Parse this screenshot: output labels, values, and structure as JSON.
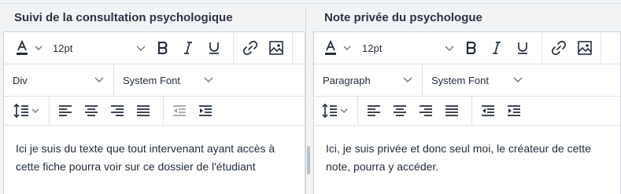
{
  "left": {
    "title": "Suivi de la consultation psychologique",
    "toolbar": {
      "font_size": "12pt",
      "block_format": "Div",
      "font_family": "System Font"
    },
    "content": "Ici je suis du texte que tout intervenant ayant accès à cette fiche pourra voir sur ce dossier de l'étudiant"
  },
  "right": {
    "title": "Note privée du psychologue",
    "toolbar": {
      "font_size": "12pt",
      "block_format": "Paragraph",
      "font_family": "System Font"
    },
    "content": "Ici, je suis privée et donc seul moi, le créateur de cette note, pourra y accéder."
  },
  "icons": [
    "text-color-icon",
    "chevron-down-icon",
    "bold-icon",
    "italic-icon",
    "underline-icon",
    "link-icon",
    "image-icon",
    "line-height-icon",
    "align-left-icon",
    "align-center-icon",
    "align-right-icon",
    "align-justify-icon",
    "outdent-icon",
    "indent-icon"
  ],
  "colors": {
    "text": "#222f3e",
    "border": "#cfd6dd",
    "background": "#f1f3f5"
  }
}
